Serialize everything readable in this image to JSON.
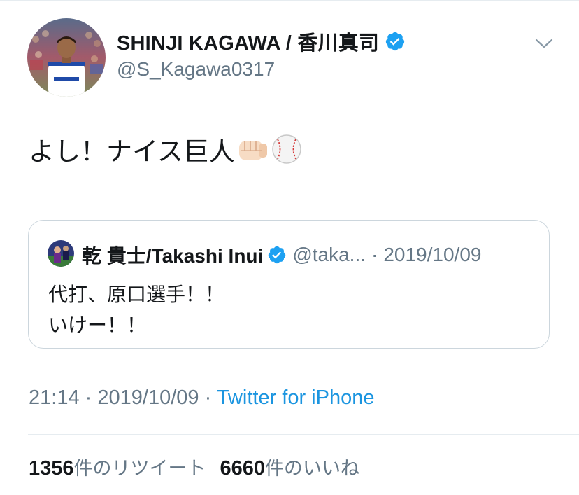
{
  "tweet": {
    "author": {
      "display_name": "SHINJI KAGAWA / 香川真司",
      "handle": "@S_Kagawa0317",
      "verified": true
    },
    "text": "よし！ナイス巨人",
    "emojis": [
      "fist-emoji",
      "baseball-emoji"
    ],
    "menu_icon": "chevron-down-icon",
    "quoted": {
      "display_name": "乾 貴士/Takashi Inui",
      "handle": "@taka...",
      "separator": "·",
      "date": "2019/10/09",
      "verified": true,
      "lines": [
        "代打、原口選手！！",
        "いけー！！"
      ]
    },
    "meta": {
      "time": "21:14",
      "sep1": "·",
      "date": "2019/10/09",
      "sep2": "·",
      "source": "Twitter for iPhone"
    },
    "stats": {
      "retweets_count": "1356",
      "retweets_label": "件のリツイート",
      "likes_count": "6660",
      "likes_label": "件のいいね"
    }
  },
  "colors": {
    "text": "#14171a",
    "secondary": "#657786",
    "link": "#1b95e0",
    "verified": "#1da1f2",
    "border": "#ccd6dd"
  }
}
